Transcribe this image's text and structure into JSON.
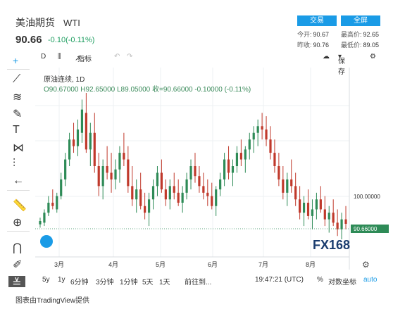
{
  "header": {
    "title": "美油期货",
    "symbol": "WTI",
    "price": "90.66",
    "change": "-0.10(-0.11%)",
    "trade_button": "交易",
    "fullscreen_button": "全屏",
    "quotes": {
      "open_label": "今开:",
      "open": "90.67",
      "high_label": "最高价:",
      "high": "92.65",
      "prev_label": "昨收:",
      "prev": "90.76",
      "low_label": "最低价:",
      "low": "89.05"
    }
  },
  "toolbar": {
    "interval": "D",
    "indicators_label": "指标",
    "save_label": "保存"
  },
  "legend": {
    "name": "原油连续, 1D",
    "ohlc": "O90.67000  H92.65000  L89.05000  收=90.66000  -0.10000 (-0.11%)"
  },
  "axis": {
    "price_tick": "100.00000",
    "current_price_tag": "90.66000",
    "months": [
      "3月",
      "4月",
      "5月",
      "6月",
      "7月",
      "8月"
    ]
  },
  "bottom": {
    "ranges": [
      "5y",
      "1y",
      "6分钟",
      "3分钟",
      "1分钟",
      "5天",
      "1天"
    ],
    "goto": "前往到...",
    "time": "19:47:21 (UTC)",
    "percent": "%",
    "log": "对数坐标",
    "auto": "auto"
  },
  "footer": "图表由TradingView提供",
  "watermark": "FX168",
  "colors": {
    "up": "#2e8b57",
    "down": "#c0392b",
    "accent": "#1a9be6",
    "brand_blue": "#1a3c6e",
    "brand_gold": "#e0a020"
  },
  "chart_data": {
    "type": "candlestick",
    "x_axis": "months",
    "y_reference": 100,
    "last": 90.66,
    "note_values": "relative level trace of daily candles",
    "series": [
      [
        0,
        90.5,
        92.5,
        89.5,
        91.5
      ],
      [
        1,
        91,
        95,
        90,
        94
      ],
      [
        2,
        94,
        99,
        93,
        97
      ],
      [
        3,
        97,
        101,
        95,
        96
      ],
      [
        4,
        95,
        100,
        94,
        99
      ],
      [
        5,
        99,
        106,
        98,
        104
      ],
      [
        6,
        104,
        112,
        102,
        110
      ],
      [
        7,
        110,
        118,
        108,
        116
      ],
      [
        8,
        116,
        121,
        112,
        114
      ],
      [
        9,
        114,
        122,
        111,
        119
      ],
      [
        10,
        118,
        128,
        115,
        125
      ],
      [
        11,
        124,
        130,
        112,
        113
      ],
      [
        12,
        113,
        121,
        108,
        118
      ],
      [
        13,
        118,
        124,
        106,
        108
      ],
      [
        14,
        108,
        112,
        99,
        102
      ],
      [
        15,
        102,
        110,
        98,
        108
      ],
      [
        16,
        108,
        114,
        104,
        106
      ],
      [
        17,
        106,
        112,
        100,
        104
      ],
      [
        18,
        104,
        110,
        101,
        107
      ],
      [
        19,
        107,
        114,
        103,
        112
      ],
      [
        20,
        112,
        118,
        108,
        110
      ],
      [
        21,
        110,
        114,
        100,
        102
      ],
      [
        22,
        102,
        108,
        96,
        98
      ],
      [
        23,
        98,
        104,
        94,
        101
      ],
      [
        24,
        101,
        106,
        95,
        96
      ],
      [
        25,
        96,
        100,
        92,
        94
      ],
      [
        26,
        94,
        100,
        90,
        98
      ],
      [
        27,
        98,
        104,
        95,
        102
      ],
      [
        28,
        102,
        108,
        99,
        106
      ],
      [
        29,
        106,
        110,
        100,
        101
      ],
      [
        30,
        101,
        104,
        96,
        98
      ],
      [
        31,
        98,
        104,
        95,
        102
      ],
      [
        32,
        102,
        106,
        98,
        100
      ],
      [
        33,
        100,
        104,
        96,
        97
      ],
      [
        34,
        97,
        102,
        94,
        100
      ],
      [
        35,
        100,
        106,
        98,
        104
      ],
      [
        36,
        104,
        110,
        101,
        108
      ],
      [
        37,
        108,
        112,
        103,
        105
      ],
      [
        38,
        105,
        108,
        100,
        102
      ],
      [
        39,
        102,
        106,
        98,
        100
      ],
      [
        40,
        100,
        104,
        96,
        99
      ],
      [
        41,
        99,
        103,
        95,
        96
      ],
      [
        42,
        96,
        102,
        93,
        101
      ],
      [
        43,
        101,
        106,
        99,
        104
      ],
      [
        44,
        104,
        112,
        102,
        110
      ],
      [
        45,
        110,
        114,
        104,
        106
      ],
      [
        46,
        106,
        110,
        102,
        108
      ],
      [
        47,
        108,
        114,
        106,
        112
      ],
      [
        48,
        112,
        116,
        108,
        110
      ],
      [
        49,
        110,
        114,
        106,
        113
      ],
      [
        50,
        113,
        118,
        110,
        116
      ],
      [
        51,
        116,
        120,
        112,
        118
      ],
      [
        52,
        118,
        122,
        114,
        120
      ],
      [
        53,
        120,
        124,
        116,
        119
      ],
      [
        54,
        119,
        123,
        114,
        116
      ],
      [
        55,
        116,
        120,
        110,
        112
      ],
      [
        56,
        112,
        116,
        106,
        108
      ],
      [
        57,
        108,
        112,
        102,
        104
      ],
      [
        58,
        104,
        108,
        98,
        100
      ],
      [
        59,
        100,
        106,
        96,
        104
      ],
      [
        60,
        104,
        110,
        100,
        102
      ],
      [
        61,
        102,
        106,
        96,
        98
      ],
      [
        62,
        98,
        102,
        92,
        94
      ],
      [
        63,
        94,
        99,
        90,
        97
      ],
      [
        64,
        97,
        101,
        92,
        93
      ],
      [
        65,
        93,
        98,
        89,
        95
      ],
      [
        66,
        95,
        100,
        92,
        98
      ],
      [
        67,
        98,
        102,
        94,
        95
      ],
      [
        68,
        95,
        99,
        90,
        92
      ],
      [
        69,
        92,
        96,
        88,
        94
      ],
      [
        70,
        94,
        98,
        90,
        91
      ],
      [
        71,
        91,
        95,
        87,
        89
      ],
      [
        72,
        89,
        94,
        86,
        92
      ],
      [
        73,
        92,
        96,
        89,
        90.66
      ]
    ]
  }
}
